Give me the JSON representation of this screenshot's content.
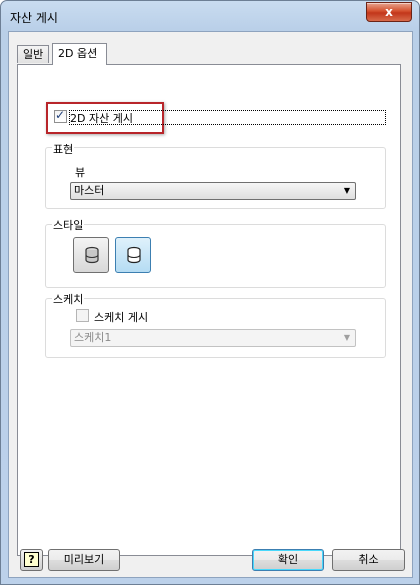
{
  "window": {
    "title": "자산 게시",
    "close_label": "x"
  },
  "tabs": [
    {
      "label": "일반",
      "selected": false
    },
    {
      "label": "2D 옵션",
      "selected": true
    }
  ],
  "publish_2d": {
    "label": "2D 자산 게시",
    "checked": true
  },
  "representation": {
    "group_label": "표현",
    "view_label": "뷰",
    "view_value": "마스터"
  },
  "style": {
    "group_label": "스타일",
    "buttons": [
      {
        "icon": "cylinder-shaded-icon",
        "active": false
      },
      {
        "icon": "cylinder-outline-icon",
        "active": true
      }
    ]
  },
  "sketch": {
    "group_label": "스케치",
    "publish_sketch_label": "스케치 게시",
    "publish_sketch_checked": false,
    "sketch_value": "스케치1"
  },
  "footer": {
    "help_label": "?",
    "preview_label": "미리보기",
    "ok_label": "확인",
    "cancel_label": "취소"
  },
  "colors": {
    "highlight": "#b8252a",
    "title_bar": "#bcd1ea"
  }
}
